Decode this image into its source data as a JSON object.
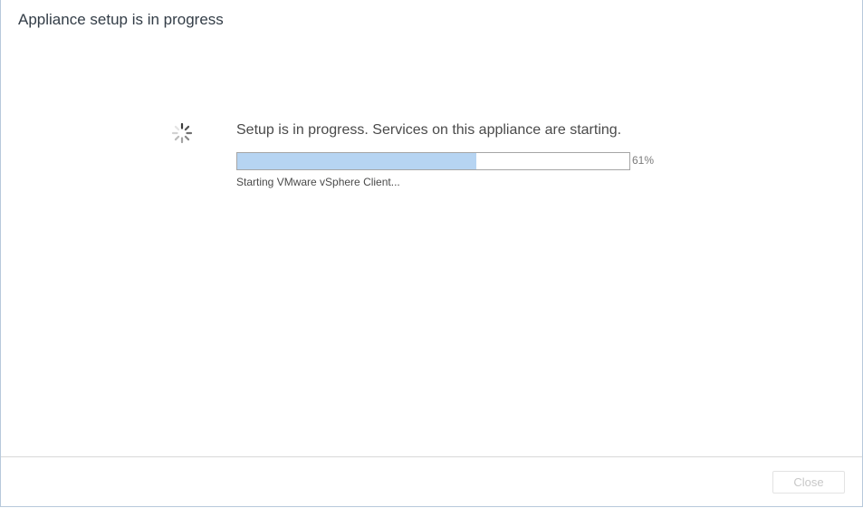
{
  "dialog": {
    "title": "Appliance setup is in progress"
  },
  "status": {
    "message": "Setup is in progress. Services on this appliance are starting.",
    "progress_percent": 61,
    "progress_label": "61%",
    "detail": "Starting VMware vSphere Client...",
    "spinner_icon": "loading-spinner-icon"
  },
  "footer": {
    "close_label": "Close",
    "close_enabled": false
  },
  "colors": {
    "progress_fill": "#b6d4f2",
    "progress_border": "#a6a6a6",
    "title_text": "#333d47",
    "disabled_text": "#c8c8c8"
  }
}
